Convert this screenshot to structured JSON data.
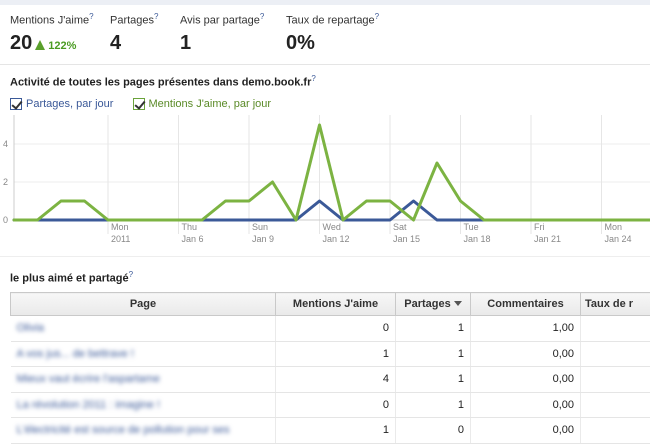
{
  "stats": [
    {
      "label": "Mentions J'aime",
      "value": "20",
      "change": "122%"
    },
    {
      "label": "Partages",
      "value": "4"
    },
    {
      "label": "Avis par partage",
      "value": "1"
    },
    {
      "label": "Taux de repartage",
      "value": "0%"
    }
  ],
  "help_glyph": "?",
  "chart_title": "Activité de toutes les pages présentes dans demo.book.fr",
  "legend": [
    {
      "label": "Partages, par jour",
      "color": "#3b5998"
    },
    {
      "label": "Mentions J'aime, par jour",
      "color": "#7cb342"
    }
  ],
  "chart_data": {
    "type": "line",
    "x": [
      "2010-12-30",
      "2010-12-31",
      "2011-01-01",
      "2011-01-02",
      "2011-01-03",
      "2011-01-04",
      "2011-01-05",
      "2011-01-06",
      "2011-01-07",
      "2011-01-08",
      "2011-01-09",
      "2011-01-10",
      "2011-01-11",
      "2011-01-12",
      "2011-01-13",
      "2011-01-14",
      "2011-01-15",
      "2011-01-16",
      "2011-01-17",
      "2011-01-18",
      "2011-01-19",
      "2011-01-20",
      "2011-01-21",
      "2011-01-22",
      "2011-01-23",
      "2011-01-24",
      "2011-01-25",
      "2011-01-26",
      "2011-01-27"
    ],
    "series": [
      {
        "name": "Partages, par jour",
        "color": "#3b5998",
        "values": [
          0,
          0,
          0,
          0,
          0,
          0,
          0,
          0,
          0,
          0,
          0,
          0,
          0,
          1,
          0,
          0,
          0,
          1,
          0,
          0,
          0,
          0,
          0,
          0,
          0,
          0,
          0,
          0,
          0
        ]
      },
      {
        "name": "Mentions J'aime, par jour",
        "color": "#7cb342",
        "values": [
          0,
          0,
          1,
          1,
          0,
          0,
          0,
          0,
          0,
          1,
          1,
          2,
          0,
          5,
          0,
          1,
          1,
          0,
          3,
          1,
          0,
          0,
          0,
          0,
          0,
          0,
          0,
          0,
          0
        ]
      }
    ],
    "y_ticks": [
      "0",
      "2",
      "4"
    ],
    "ylim": [
      0,
      5.5
    ],
    "x_ticks": [
      {
        "day": "Mon",
        "date": "2011",
        "index": 4
      },
      {
        "day": "Thu",
        "date": "Jan 6",
        "index": 7
      },
      {
        "day": "Sun",
        "date": "Jan 9",
        "index": 10
      },
      {
        "day": "Wed",
        "date": "Jan 12",
        "index": 13
      },
      {
        "day": "Sat",
        "date": "Jan 15",
        "index": 16
      },
      {
        "day": "Tue",
        "date": "Jan 18",
        "index": 19
      },
      {
        "day": "Fri",
        "date": "Jan 21",
        "index": 22
      },
      {
        "day": "Mon",
        "date": "Jan 24",
        "index": 25
      }
    ],
    "grid": true
  },
  "table": {
    "title": "le plus aimé et partagé",
    "columns": [
      "Page",
      "Mentions J'aime",
      "Partages",
      "Commentaires",
      "Taux de r"
    ],
    "sorted_column": "Partages",
    "rows": [
      {
        "page": "Olivia",
        "likes": "0",
        "shares": "1",
        "comments": "1,00",
        "rate": ""
      },
      {
        "page": "A vos jus... de bettrave !",
        "likes": "1",
        "shares": "1",
        "comments": "0,00",
        "rate": ""
      },
      {
        "page": "Mieux vaut écrire l'aspartame",
        "likes": "4",
        "shares": "1",
        "comments": "0,00",
        "rate": ""
      },
      {
        "page": "La révolution 2011 : imagine !",
        "likes": "0",
        "shares": "1",
        "comments": "0,00",
        "rate": ""
      },
      {
        "page": "L'électricité est source de pollution pour ses",
        "likes": "1",
        "shares": "0",
        "comments": "0,00",
        "rate": ""
      }
    ]
  }
}
